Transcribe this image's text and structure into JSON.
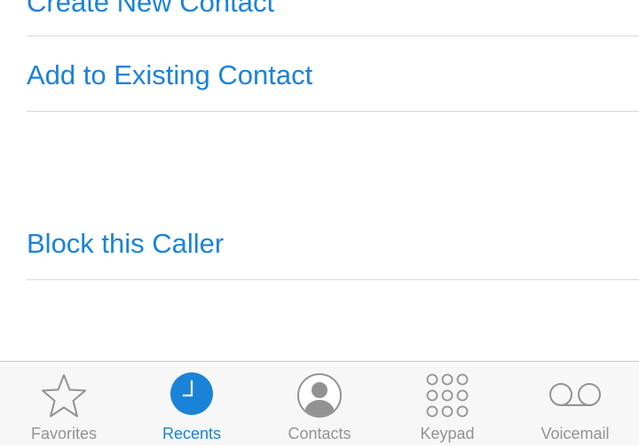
{
  "actions": {
    "create_new_contact": "Create New Contact",
    "add_to_existing_contact": "Add to Existing Contact",
    "block_this_caller": "Block this Caller"
  },
  "tab_bar": {
    "active_tab": "Recents",
    "tabs": [
      {
        "label": "Favorites",
        "icon": "star-icon"
      },
      {
        "label": "Recents",
        "icon": "clock-icon"
      },
      {
        "label": "Contacts",
        "icon": "person-icon"
      },
      {
        "label": "Keypad",
        "icon": "keypad-icon"
      },
      {
        "label": "Voicemail",
        "icon": "voicemail-icon"
      }
    ]
  },
  "colors": {
    "accent": "#1a83d7",
    "inactive": "#929292",
    "separator": "#d9d9de",
    "tab_bar_background": "#f7f7f8"
  }
}
